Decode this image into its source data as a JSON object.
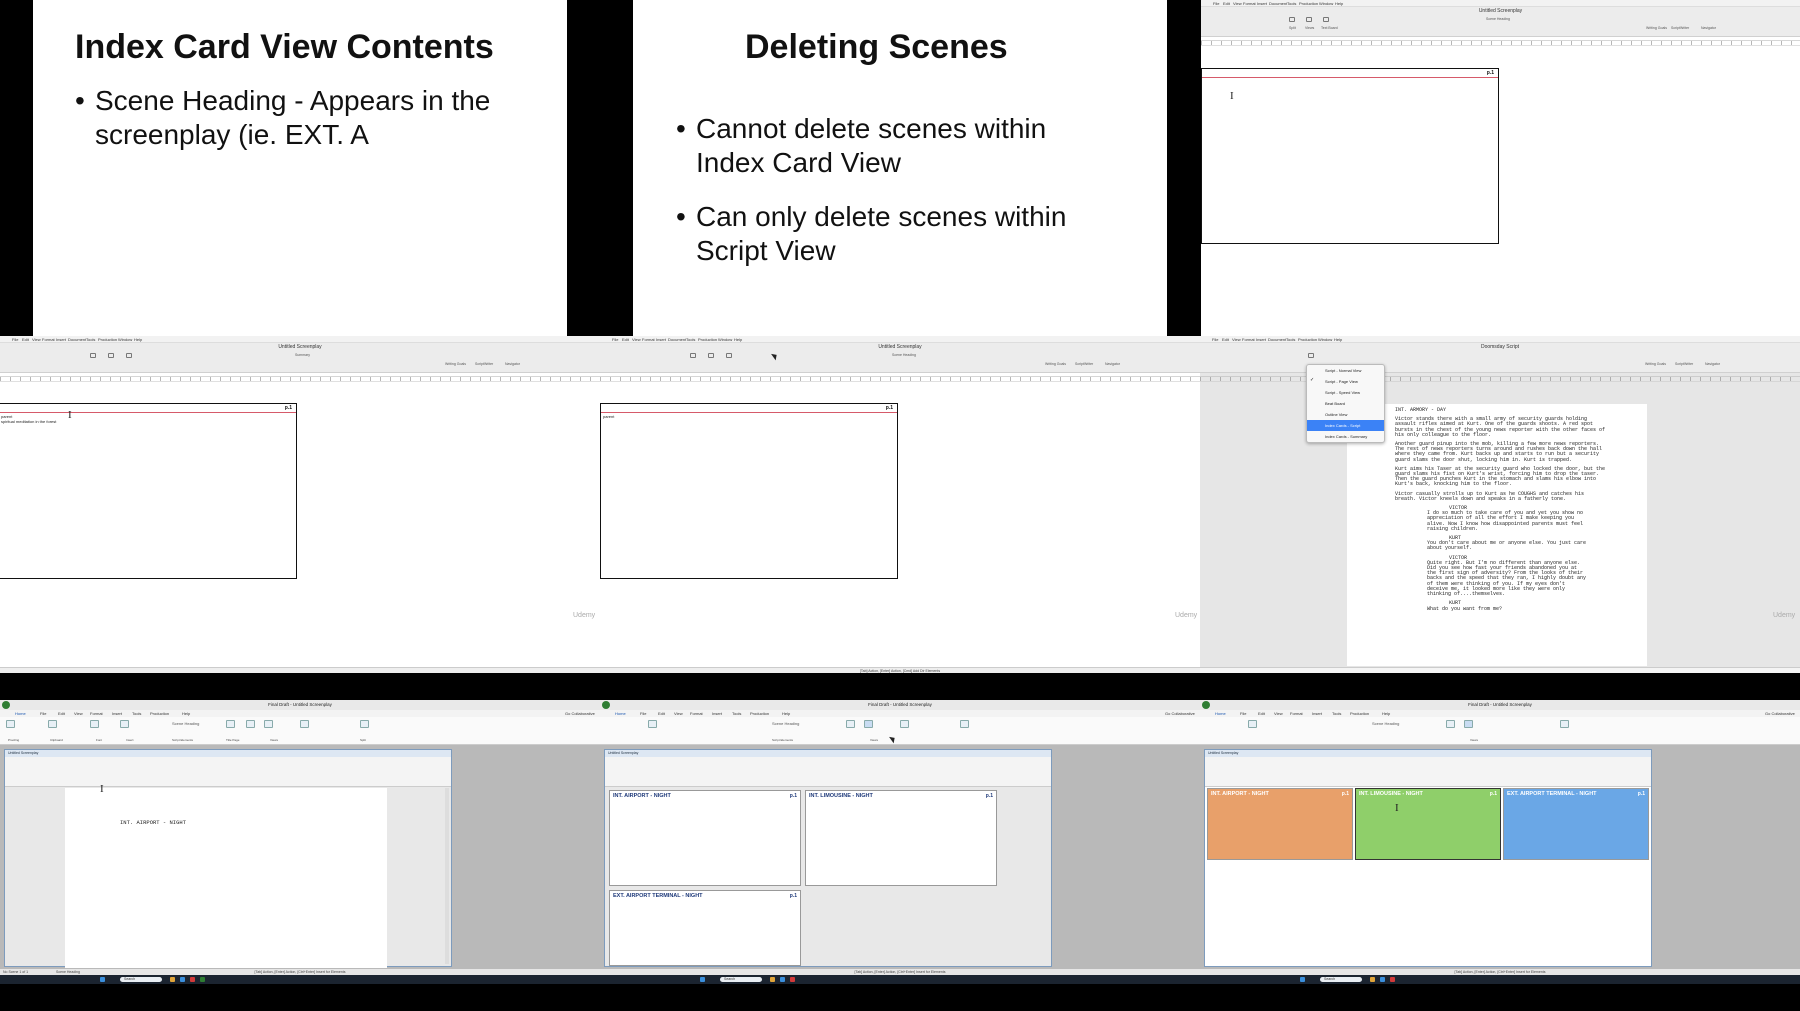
{
  "slide1": {
    "title": "Index Card View Contents",
    "bullets": [
      "Scene Heading - Appears in the screenplay (ie. EXT. A"
    ],
    "watermark": ""
  },
  "slide2": {
    "title": "Deleting Scenes",
    "bullets": [
      "Cannot delete scenes within Index Card View",
      "Can only delete scenes within Script View"
    ],
    "watermark": "Udemy"
  },
  "mac": {
    "menu": [
      "File",
      "Edit",
      "View",
      "Format",
      "Insert",
      "Document",
      "Tools",
      "Production",
      "Window",
      "Help"
    ],
    "doc_title": "Untitled Screenplay",
    "element_label": "Scene Heading",
    "summary_label": "Summary",
    "toolbar": [
      "Split",
      "Views",
      "Text Board"
    ],
    "toolbar_right": [
      "Writing Goals",
      "ScriptWriter",
      "Navigator"
    ],
    "card_page": "p.1",
    "card_text_a": "parent",
    "card_text_b": "spiritual meditation in the forest",
    "card_text_c": "parent",
    "status": "[Tab] Action, [Enter] Action, [Cmd] Add Dir Elements"
  },
  "mac_menu": {
    "items": [
      "Script - Normal View",
      "Script - Page View",
      "Script - Speed View",
      "Beat Board",
      "Outline View",
      "Index Cards - Script",
      "Index Cards - Summary"
    ],
    "selected": 5,
    "checked": 1,
    "doc_title": "Doomsday Script"
  },
  "script": {
    "heading": "INT. ARMORY - DAY",
    "action": [
      "Victor stands there with a small army of security guards holding assault rifles aimed at Kurt. One of the guards shoots. A red spot bursts in the chest of the young news reporter with the other faces of his only colleague to the floor.",
      "Another guard pinup into the mob, killing a few more news reporters. The rest of news reporters turns around and rushes back down the hall where they came from. Kurt backs up and starts to run but a security guard slams the door shut, locking him in. Kurt is trapped.",
      "Kurt aims his Taser at the security guard who locked the door, but the guard slams his fist on Kurt's wrist, forcing him to drop the taser. Then the guard punches Kurt in the stomach and slams his elbow into Kurt's back, knocking him to the floor.",
      "Victor casually strolls up to Kurt as he COUGHS and catches his breath. Victor kneels down and speaks in a fatherly tone."
    ],
    "dialogue": [
      {
        "char": "VICTOR",
        "line": "I do so much to take care of you and yet you show no appreciation of all the effort I make keeping you alive. Now I know how disappointed parents must feel raising children."
      },
      {
        "char": "KURT",
        "line": "You don't care about me or anyone else. You just care about yourself."
      },
      {
        "char": "VICTOR",
        "line": "Quite right. But I'm no different than anyone else. Did you see how fast your friends abandoned you at the first sign of adversity? From the looks of their backs and the speed that they ran, I highly doubt any of them were thinking of you. If my eyes don't deceive me, it looked more like they were only thinking of....themselves."
      },
      {
        "char": "KURT",
        "line": "What do you want from me?"
      }
    ]
  },
  "win": {
    "title": "Final Draft - Untitled Screenplay",
    "tabs": [
      "Home",
      "File",
      "Edit",
      "View",
      "Format",
      "Insert",
      "Tools",
      "Production",
      "Help"
    ],
    "collab": "Go Collaborative",
    "ribbon_groups": [
      "Proofing",
      "Clipboard",
      "Font",
      "Insert",
      "Script Elements",
      "Title Page",
      "Views",
      "Split"
    ],
    "element": "Scene Heading",
    "doc_window": "Untitled Screenplay",
    "script_heading": "INT. AIRPORT - NIGHT",
    "status_left": "No Scene  1 of 1",
    "status_elem": "Scene Heading",
    "status_hint": "[Tab] Action, [Enter] Action, [Ctrl+Enter] Insert for Elements",
    "search": "Search",
    "cards": [
      {
        "title": "INT. AIRPORT - NIGHT",
        "page": "p.1"
      },
      {
        "title": "INT. LIMOUSINE - NIGHT",
        "page": "p.1"
      },
      {
        "title": "EXT. AIRPORT TERMINAL - NIGHT",
        "page": "p.1"
      }
    ],
    "colors": {
      "orange": "#e8a06a",
      "green": "#8fcf6a",
      "blue": "#6aa7e6"
    }
  }
}
